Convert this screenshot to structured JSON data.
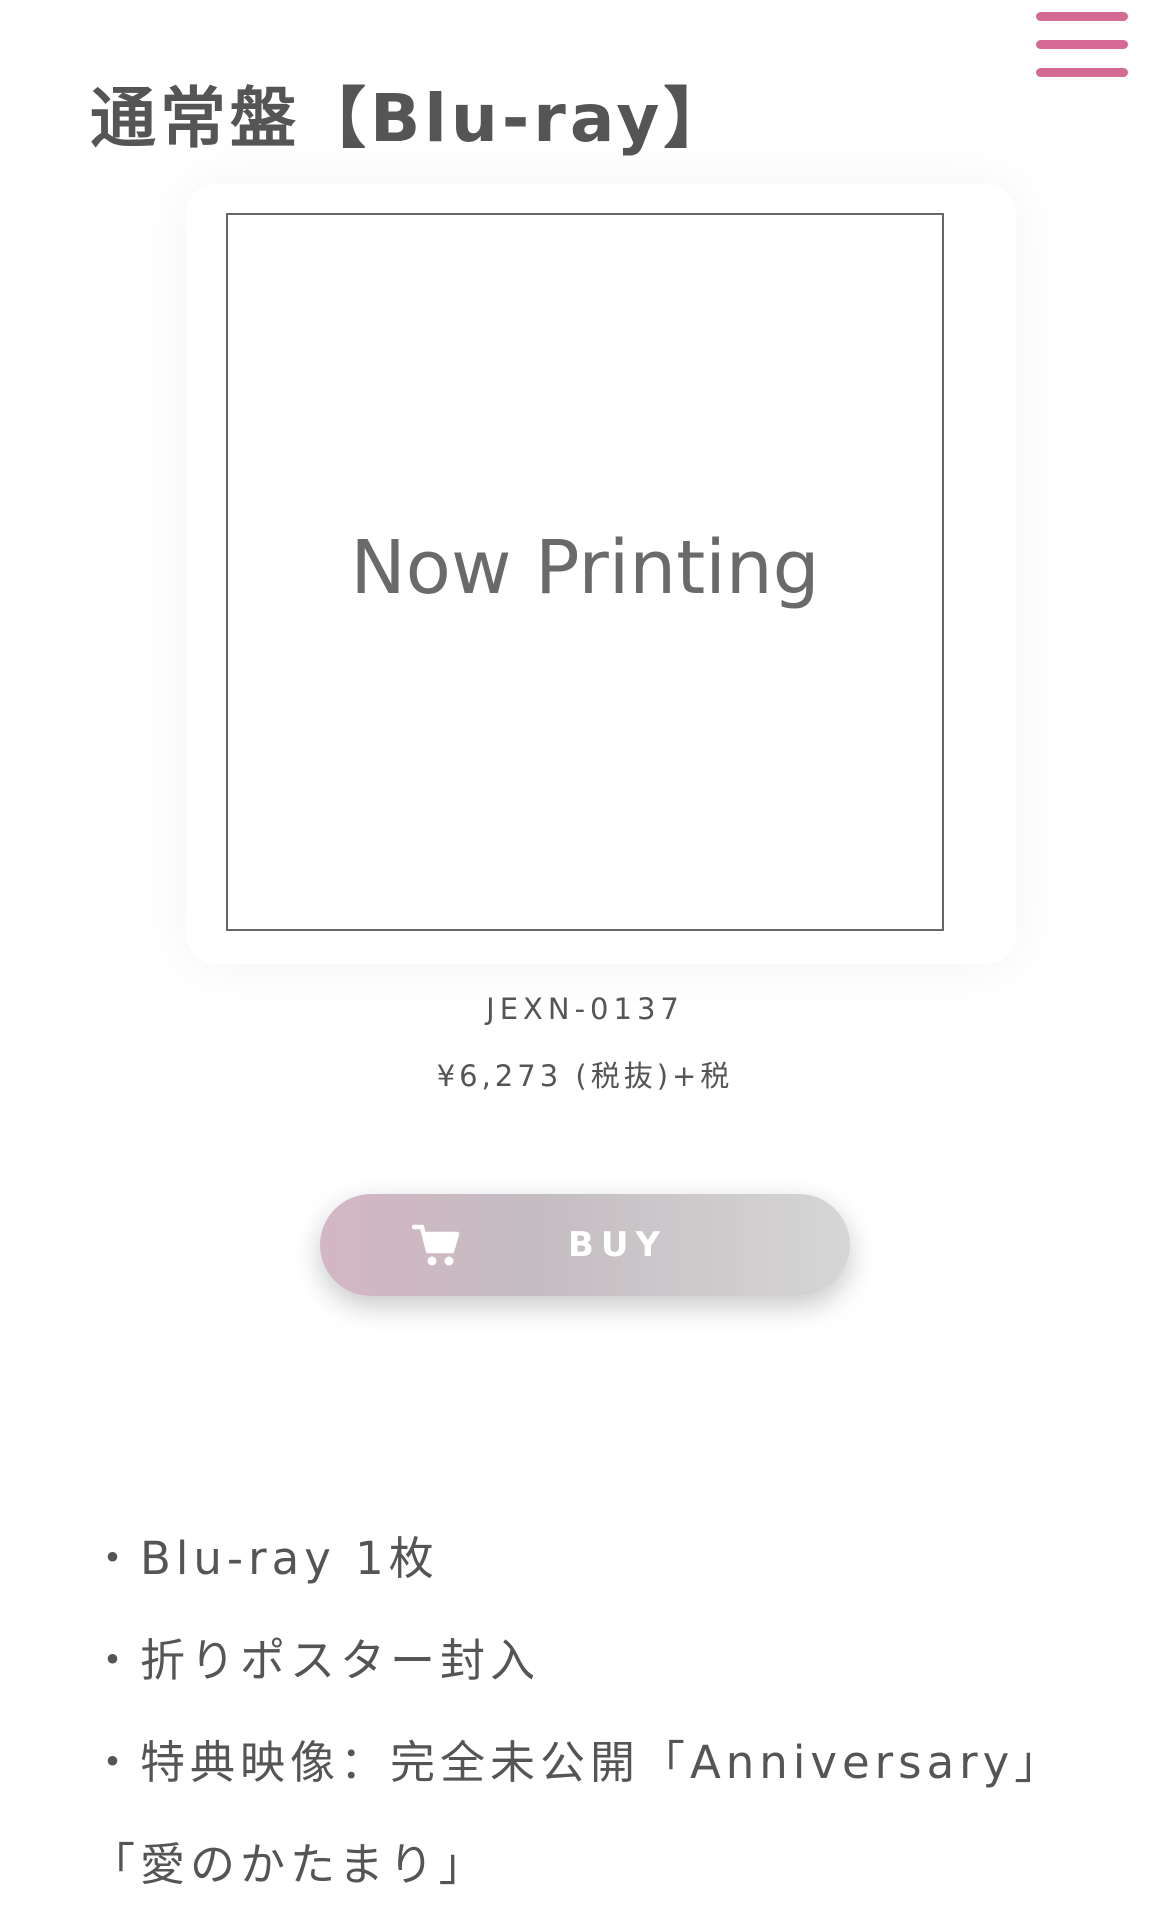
{
  "header": {
    "title": "通常盤【Blu-ray】"
  },
  "product": {
    "jacket_placeholder": "Now Printing",
    "code": "JEXN-0137",
    "price": "¥6,273 (税抜)+税",
    "buy_label": "BUY",
    "buy_icon": "cart-icon"
  },
  "details": [
    "・Blu-ray 1枚",
    "・折りポスター封入",
    "・特典映像：完全未公開「Anniversary」「愛のかたまり」"
  ],
  "colors": {
    "menu_accent": "#d46a94",
    "text": "#555555",
    "buy_gradient_start": "#d4b6c4",
    "buy_gradient_end": "#d6d6d6"
  }
}
